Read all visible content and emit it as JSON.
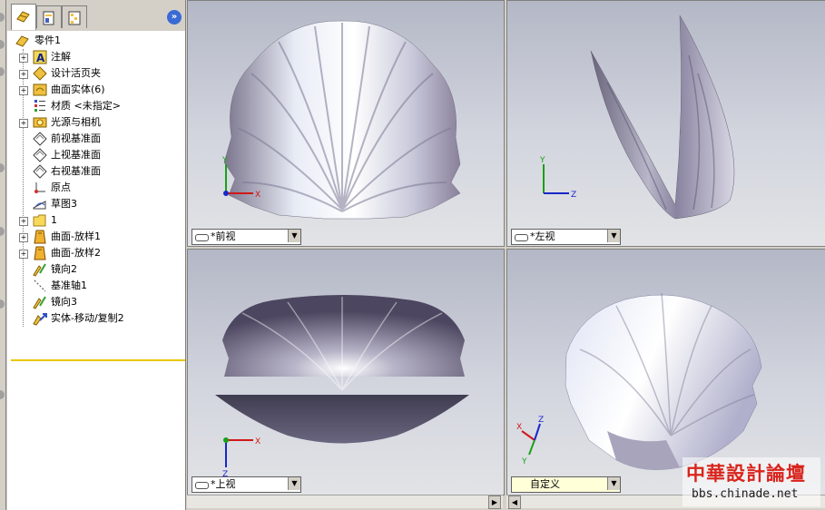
{
  "feature_tree": {
    "items": [
      {
        "label": "零件1",
        "icon": "part-icon",
        "expandable": false
      },
      {
        "label": "注解",
        "icon": "annotation-icon",
        "expandable": true
      },
      {
        "label": "设计活页夹",
        "icon": "design-binder-icon",
        "expandable": true
      },
      {
        "label": "曲面实体(6)",
        "icon": "surface-bodies-icon",
        "expandable": true
      },
      {
        "label": "材质 <未指定>",
        "icon": "material-icon",
        "expandable": false
      },
      {
        "label": "光源与相机",
        "icon": "lights-cameras-icon",
        "expandable": true
      },
      {
        "label": "前视基准面",
        "icon": "plane-icon",
        "expandable": false
      },
      {
        "label": "上视基准面",
        "icon": "plane-icon",
        "expandable": false
      },
      {
        "label": "右视基准面",
        "icon": "plane-icon",
        "expandable": false
      },
      {
        "label": "原点",
        "icon": "origin-icon",
        "expandable": false
      },
      {
        "label": "草图3",
        "icon": "sketch-icon",
        "expandable": false
      },
      {
        "label": "1",
        "icon": "folder-icon",
        "expandable": true
      },
      {
        "label": "曲面-放样1",
        "icon": "loft-icon",
        "expandable": true
      },
      {
        "label": "曲面-放样2",
        "icon": "loft-icon",
        "expandable": true
      },
      {
        "label": "镜向2",
        "icon": "mirror-icon",
        "expandable": false
      },
      {
        "label": "基准轴1",
        "icon": "axis-icon",
        "expandable": false
      },
      {
        "label": "镜向3",
        "icon": "mirror-icon",
        "expandable": false
      },
      {
        "label": "实体-移动/复制2",
        "icon": "move-copy-icon",
        "expandable": false
      }
    ]
  },
  "viewports": {
    "front": {
      "label": "*前视",
      "axes": [
        "Y",
        "X"
      ]
    },
    "left": {
      "label": "*左视",
      "axes": [
        "Y",
        "Z"
      ]
    },
    "top": {
      "label": "*上视",
      "axes": [
        "X",
        "Z"
      ]
    },
    "custom": {
      "label": "自定义",
      "axes": [
        "X",
        "Y",
        "Z"
      ]
    }
  },
  "watermark": {
    "title": "中華設計論壇",
    "url": "bbs.chinade.net"
  },
  "colors": {
    "axis_x": "#d01818",
    "axis_y": "#18a018",
    "axis_z": "#1828c8",
    "label_active": "#ffffd8"
  }
}
